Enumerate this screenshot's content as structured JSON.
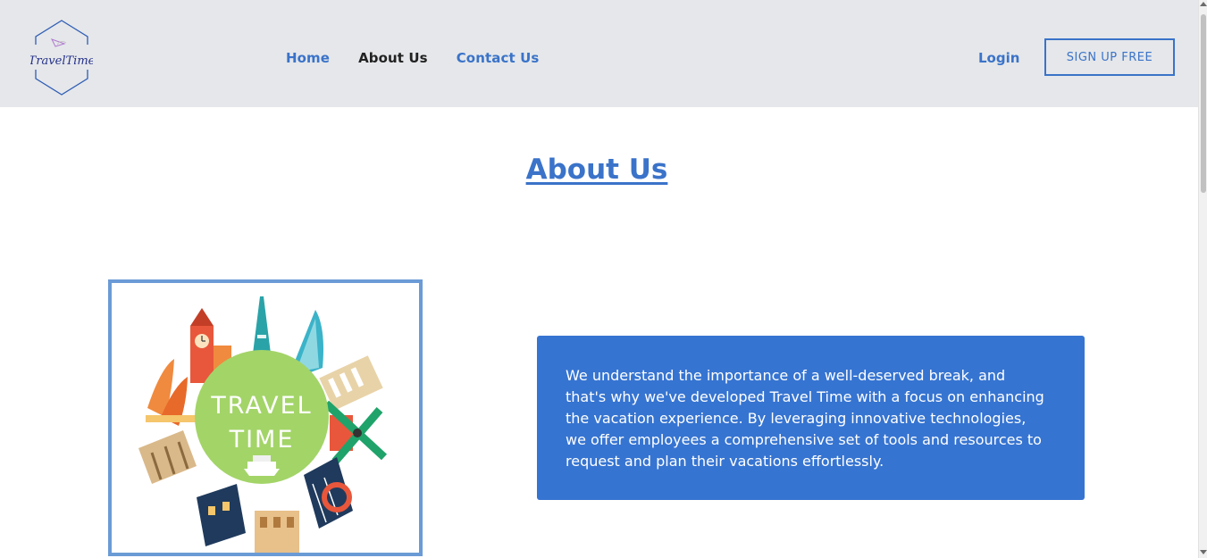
{
  "header": {
    "logo_text": "TravelTime",
    "nav": [
      {
        "label": "Home",
        "active": false
      },
      {
        "label": "About Us",
        "active": true
      },
      {
        "label": "Contact Us",
        "active": false
      }
    ],
    "login_label": "Login",
    "signup_label": "SIGN UP FREE"
  },
  "main": {
    "title": "About Us",
    "image": {
      "text_line1": "TRAVEL",
      "text_line2": "TIME"
    },
    "description": "We understand the importance of a well-deserved break, and that's why we've developed Travel Time with a focus on enhancing the vacation experience. By leveraging innovative technologies, we offer employees a comprehensive set of tools and resources to request and plan their vacations effortlessly."
  },
  "colors": {
    "accent": "#3a73c9",
    "header_bg": "#e5e7ea",
    "info_box_bg": "#3674d1",
    "image_border": "#6b9bd6",
    "badge_green": "#a3d468"
  }
}
